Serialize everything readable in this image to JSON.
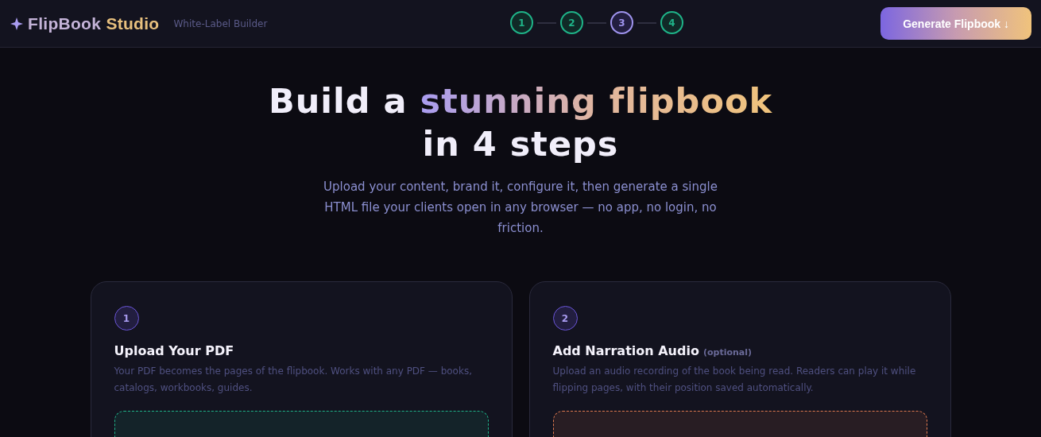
{
  "header": {
    "brand_lead": "FlipBook",
    "brand_tail": "Studio",
    "subtitle": "White-Label Builder",
    "steps": [
      {
        "label": "1",
        "selected": false
      },
      {
        "label": "2",
        "selected": false
      },
      {
        "label": "3",
        "selected": true
      },
      {
        "label": "4",
        "selected": false
      }
    ],
    "button": "Generate Flipbook ↓"
  },
  "hero": {
    "lead": "Build a",
    "highlight": "stunning flipbook",
    "tail": "in 4 steps",
    "description": "Upload your content, brand it, configure it, then generate a single HTML file your clients open in any browser — no app, no login, no friction."
  },
  "cards": [
    {
      "number": "1",
      "title": "Upload Your PDF",
      "description": "Your PDF becomes the pages of the flipbook. Works with any PDF — books, catalogs, workbooks, guides.",
      "color": "#1fb489"
    },
    {
      "number": "2",
      "title": "Add Narration Audio",
      "tag": "(optional)",
      "description": "Upload an audio recording of the book being read. Readers can play it while flipping pages, with their position saved automatically.",
      "color": "#e07a4f"
    }
  ]
}
